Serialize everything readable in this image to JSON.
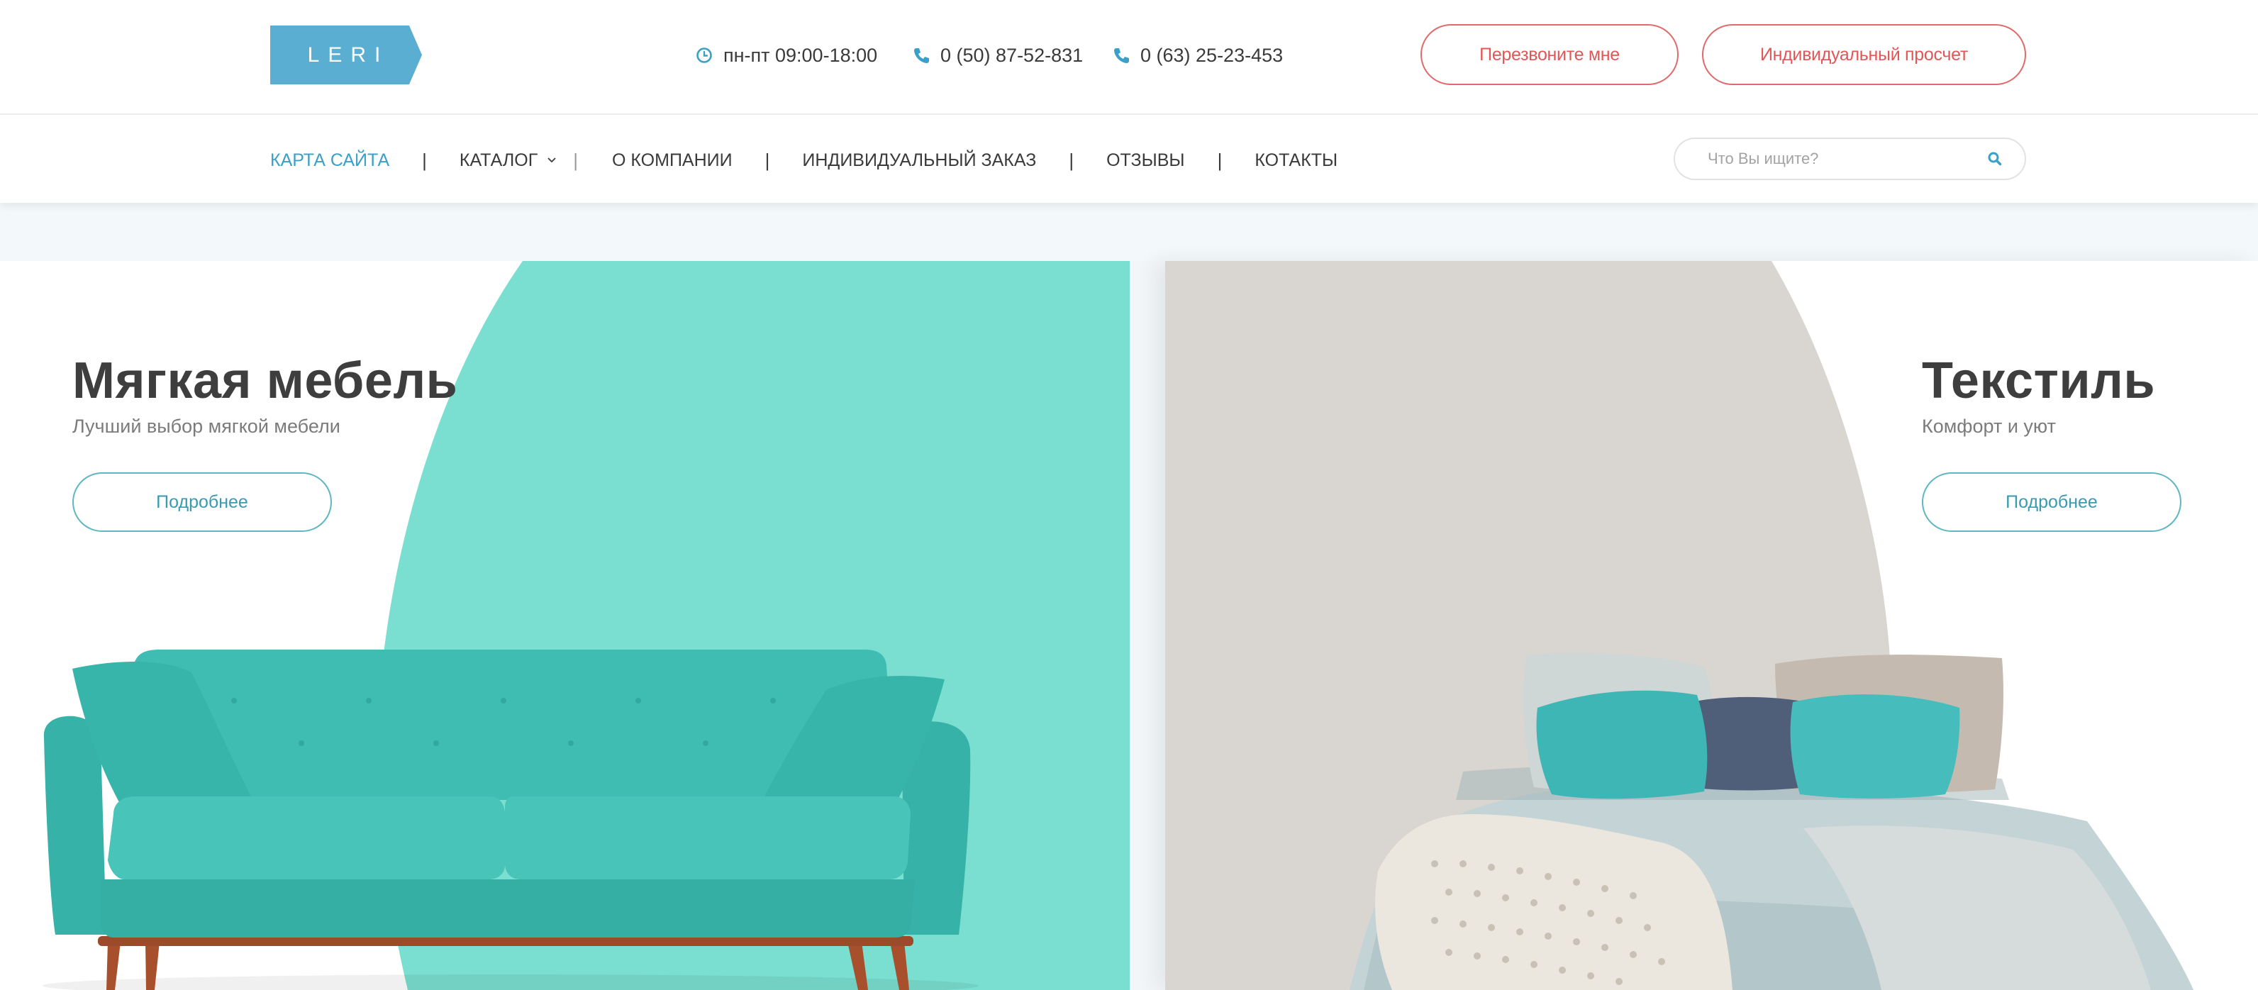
{
  "header": {
    "logo_text": "LERI",
    "hours": "пн-пт 09:00-18:00",
    "phone1": "0 (50) 87-52-831",
    "phone2": "0 (63) 25-23-453",
    "callback_label": "Перезвоните мне",
    "calc_label": "Индивидуальный просчет",
    "accent_color": "#5aaed2",
    "button_color": "#e25656"
  },
  "nav": {
    "items": [
      {
        "label": "КАРТА САЙТА",
        "active": true
      },
      {
        "label": "КАТАЛОГ",
        "has_dropdown": true
      },
      {
        "label": "О КОМПАНИИ"
      },
      {
        "label": "ИНДИВИДУАЛЬНЫЙ ЗАКАЗ"
      },
      {
        "label": "ОТЗЫВЫ"
      },
      {
        "label": "КОТАКТЫ"
      }
    ],
    "separator": "|",
    "search_placeholder": "Что Вы ищите?"
  },
  "banners": [
    {
      "title": "Мягкая мебель",
      "subtitle": "Лучший выбор мягкой мебели",
      "button": "Подробнее",
      "bg_shape_color": "#7adfd0",
      "image": "teal-sofa"
    },
    {
      "title": "Текстиль",
      "subtitle": "Комфорт и уют",
      "button": "Подробнее",
      "bg_shape_color": "#d9d6d1",
      "image": "bed-with-pillows"
    }
  ]
}
